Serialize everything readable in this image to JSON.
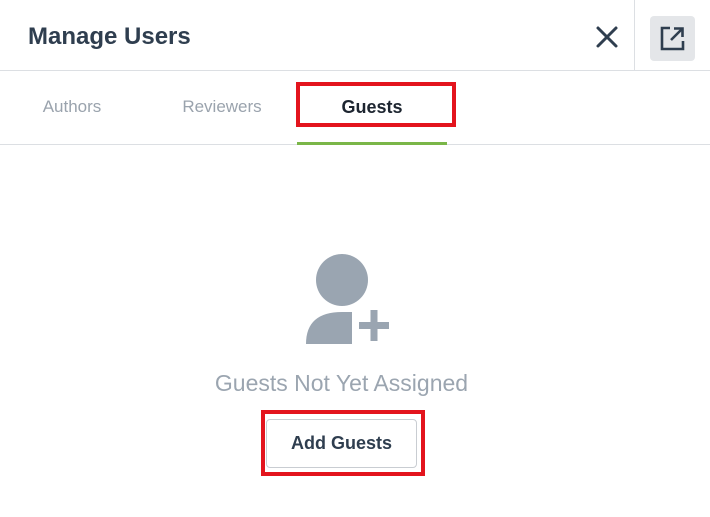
{
  "header": {
    "title": "Manage Users",
    "close_icon": "close-icon",
    "popout_icon": "external-link-icon"
  },
  "tabs": [
    {
      "label": "Authors",
      "active": false
    },
    {
      "label": "Reviewers",
      "active": false
    },
    {
      "label": "Guests",
      "active": true
    }
  ],
  "empty_state": {
    "icon": "add-user-icon",
    "message": "Guests Not Yet Assigned",
    "button_label": "Add Guests"
  },
  "colors": {
    "active_tab_underline": "#7ab648",
    "highlight_outline": "#e3141d",
    "title_text": "#2f3e4f",
    "muted_text": "#9ba5b0",
    "icon_gray": "#9aa5b1"
  }
}
